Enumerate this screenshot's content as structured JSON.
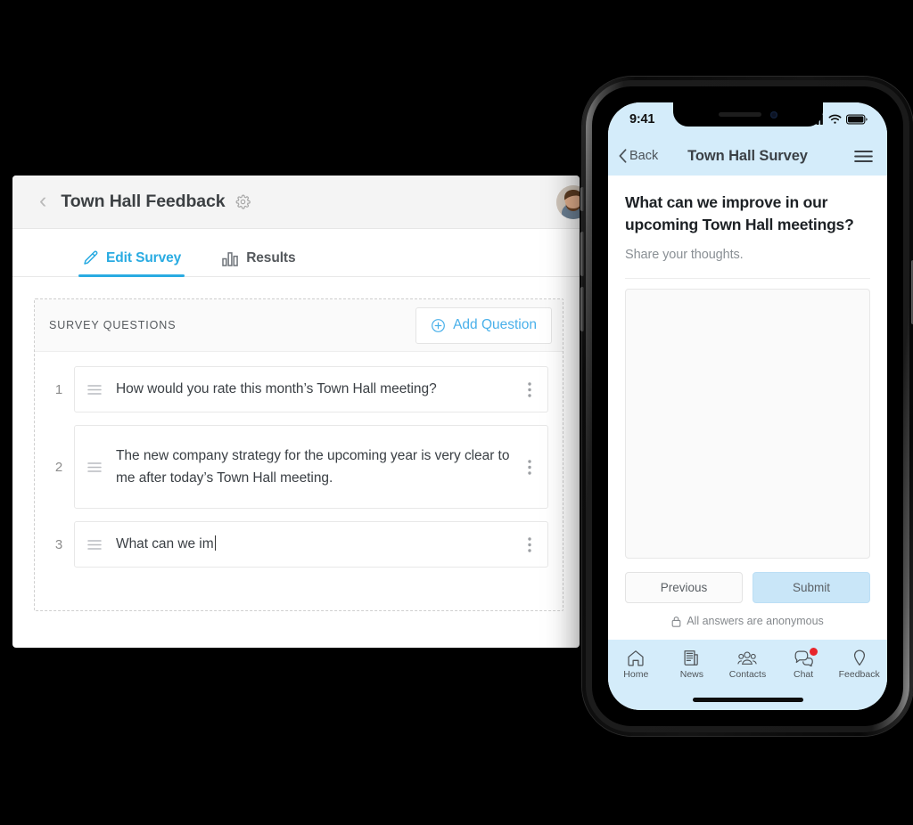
{
  "desktop": {
    "header": {
      "back_icon": "chevron-left-icon",
      "title": "Town Hall Feedback",
      "settings_icon": "gear-icon",
      "avatar": "user-avatar"
    },
    "tabs": [
      {
        "label": "Edit Survey",
        "icon": "pencil-icon",
        "active": true
      },
      {
        "label": "Results",
        "icon": "bar-chart-icon",
        "active": false
      }
    ],
    "panel": {
      "title": "SURVEY QUESTIONS",
      "add_button": {
        "label": "Add Question",
        "icon": "plus-circle-icon"
      },
      "questions": [
        {
          "num": "1",
          "text": "How would you rate this month’s Town Hall meeting?",
          "tall": false,
          "caret": false
        },
        {
          "num": "2",
          "text": "The new company strategy for the upcoming year is very clear to me after today’s Town Hall meeting.",
          "tall": true,
          "caret": false
        },
        {
          "num": "3",
          "text": "What can we im",
          "tall": false,
          "caret": true
        }
      ],
      "drag_icon": "drag-handle-icon",
      "menu_icon": "kebab-menu-icon"
    }
  },
  "phone": {
    "status": {
      "time": "9:41",
      "signal_icon": "cellular-signal-icon",
      "wifi_icon": "wifi-icon",
      "battery_icon": "battery-full-icon"
    },
    "navbar": {
      "back_label": "Back",
      "back_icon": "chevron-left-icon",
      "title": "Town Hall Survey",
      "menu_icon": "hamburger-menu-icon"
    },
    "survey": {
      "question": "What can we improve in our upcoming Town Hall meetings?",
      "subtitle": "Share your thoughts.",
      "answer_value": "",
      "answer_placeholder": "",
      "previous_label": "Previous",
      "submit_label": "Submit",
      "anonymous_note": "All answers are anonymous",
      "lock_icon": "lock-icon"
    },
    "tabbar": [
      {
        "label": "Home",
        "icon": "home-icon",
        "badge": false
      },
      {
        "label": "News",
        "icon": "news-icon",
        "badge": false
      },
      {
        "label": "Contacts",
        "icon": "contacts-icon",
        "badge": false
      },
      {
        "label": "Chat",
        "icon": "chat-icon",
        "badge": true
      },
      {
        "label": "Feedback",
        "icon": "pin-icon",
        "badge": false
      }
    ]
  },
  "colors": {
    "accent": "#29abe2",
    "phone_chrome": "#d4ecfa",
    "submit_bg": "#c9e6f8",
    "badge": "#e8252a",
    "background": "#000000"
  }
}
